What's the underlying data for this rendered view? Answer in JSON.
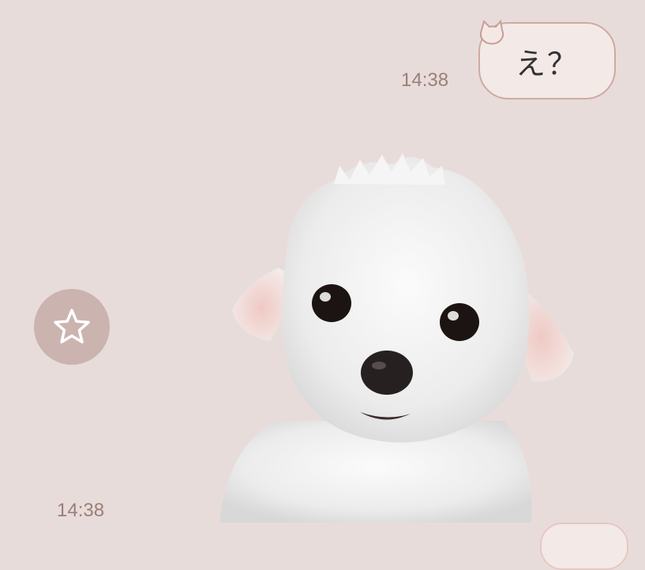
{
  "messages": [
    {
      "text": "え？",
      "time": "14:38"
    }
  ],
  "sticker": {
    "time": "14:38"
  },
  "icons": {
    "favorite": "star-icon",
    "bubble_decoration": "cat-icon"
  },
  "colors": {
    "background": "#e8dcda",
    "bubble": "#f3e9e7",
    "bubble_border": "#cfa9a2",
    "timestamp": "#9a7f78",
    "favorite_button": "#cbb3af"
  }
}
